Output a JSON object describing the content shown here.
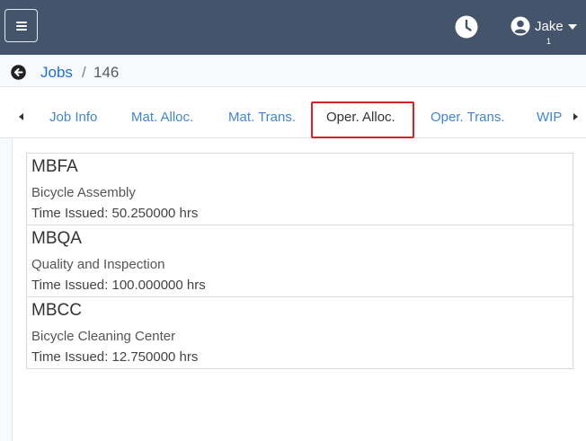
{
  "header": {
    "user_name": "Jake",
    "user_count": "1",
    "icons": {
      "menu": "hamburger-menu-icon",
      "clock": "clock-icon",
      "user": "user-circle-icon"
    }
  },
  "breadcrumb": {
    "parent": "Jobs",
    "separator": "/",
    "current": "146"
  },
  "tabs": [
    {
      "label": "Job Info",
      "active": false
    },
    {
      "label": "Mat. Alloc.",
      "active": false
    },
    {
      "label": "Mat. Trans.",
      "active": false
    },
    {
      "label": "Oper. Alloc.",
      "active": true
    },
    {
      "label": "Oper. Trans.",
      "active": false
    },
    {
      "label": "WIP",
      "active": false
    }
  ],
  "operations": [
    {
      "code": "MBFA",
      "description": "Bicycle Assembly",
      "time": "Time Issued: 50.250000 hrs"
    },
    {
      "code": "MBQA",
      "description": "Quality and Inspection",
      "time": "Time Issued: 100.000000 hrs"
    },
    {
      "code": "MBCC",
      "description": "Bicycle Cleaning Center",
      "time": "Time Issued: 12.750000 hrs"
    }
  ],
  "colors": {
    "header_bg": "#44546a",
    "link": "#3f86d4",
    "highlight": "#d6222a"
  }
}
